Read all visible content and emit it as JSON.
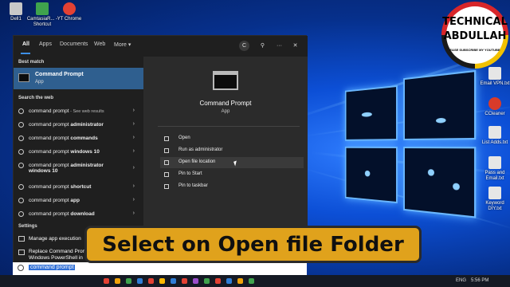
{
  "desktop": {
    "icons_left": [
      {
        "label": "Dell1",
        "color": "#c8c8c8"
      },
      {
        "label": "CamtasiaR... - Shortcut",
        "color": "#3fa34d"
      },
      {
        "label": "YT Chrome",
        "color": "#e34133"
      }
    ],
    "icons_right": [
      {
        "label": "Email VPN.txt",
        "color": "#e6e6e6"
      },
      {
        "label": "CCleaner",
        "color": "#d83b2a"
      },
      {
        "label": "List Adds.txt",
        "color": "#e6e6e6"
      },
      {
        "label": "Pass and Email.txt",
        "color": "#e6e6e6"
      },
      {
        "label": "Keyword DIY.txt",
        "color": "#e6e6e6"
      }
    ]
  },
  "branding": {
    "line1": "TECHNICAL",
    "line2": "ABDULLAH",
    "subtext": "EASE SUBSCRIBE MY YOUTUBE"
  },
  "start_menu": {
    "tabs": [
      "All",
      "Apps",
      "Documents",
      "Web",
      "More"
    ],
    "more_caret": "▾",
    "toolbar": {
      "account_initial": "C",
      "feedback_icon": "⚲",
      "more_icon": "···",
      "close_icon": "✕"
    },
    "best_match_label": "Best match",
    "best_match": {
      "title": "Command Prompt",
      "type": "App"
    },
    "search_web_label": "Search the web",
    "web_results": [
      {
        "prefix": "command prompt",
        "suffix": " - See web results"
      },
      {
        "prefix": "command prompt ",
        "bold": "administrator"
      },
      {
        "prefix": "command prompt ",
        "bold": "commands"
      },
      {
        "prefix": "command prompt ",
        "bold": "windows 10"
      },
      {
        "prefix": "command prompt ",
        "bold": "administrator",
        "line2": "windows 10"
      },
      {
        "prefix": "command prompt ",
        "bold": "shortcut"
      },
      {
        "prefix": "command prompt ",
        "bold": "app"
      },
      {
        "prefix": "command prompt ",
        "bold": "download"
      }
    ],
    "settings_label": "Settings",
    "settings": [
      {
        "label": "Manage app execution"
      },
      {
        "label": "Replace Command Prom",
        "line2": "Windows PowerShell in"
      }
    ],
    "chevron": "›",
    "right_pane": {
      "title": "Command Prompt",
      "type": "App",
      "actions": [
        "Open",
        "Run as administrator",
        "Open file location",
        "Pin to Start",
        "Pin to taskbar"
      ]
    }
  },
  "search_bar": {
    "value": "command prompt"
  },
  "taskbar": {
    "language": "ENG",
    "time": "5:56 PM",
    "app_colors": [
      "#e34133",
      "#f0a30a",
      "#3fa34d",
      "#2f7dd6",
      "#e34133",
      "#ffb900",
      "#2f7dd6",
      "#e34133",
      "#9b4dca",
      "#3fa34d",
      "#e34133",
      "#2f7dd6",
      "#f0a30a",
      "#3fa34d"
    ]
  },
  "caption": "Select on Open file Folder"
}
